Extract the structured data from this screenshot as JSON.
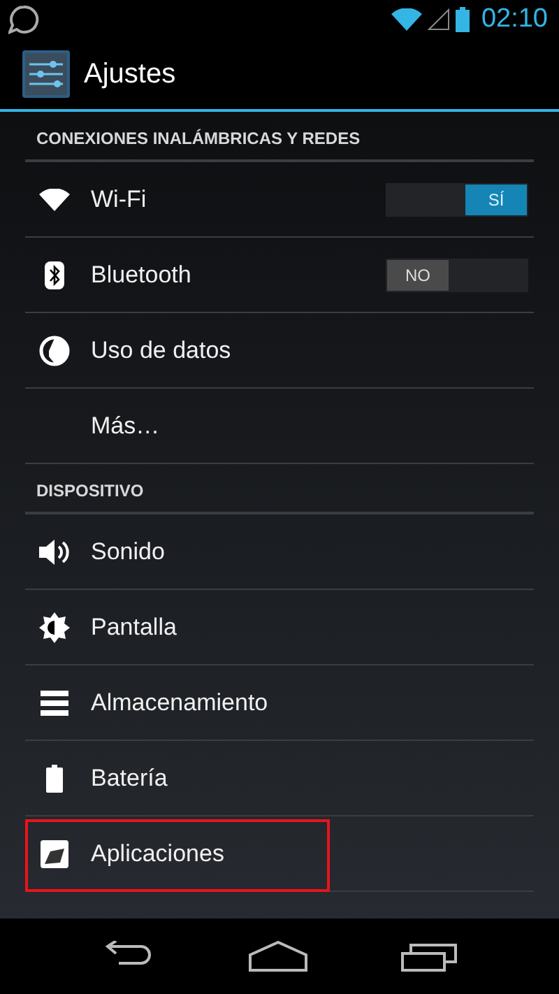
{
  "status_bar": {
    "time": "02:10"
  },
  "action_bar": {
    "title": "Ajustes"
  },
  "sections": [
    {
      "header": "CONEXIONES INALÁMBRICAS Y REDES",
      "items": [
        {
          "label": "Wi-Fi",
          "kind": "toggle",
          "toggle": {
            "on": true,
            "text": "SÍ"
          },
          "highlighted": false
        },
        {
          "label": "Bluetooth",
          "kind": "toggle",
          "toggle": {
            "on": false,
            "text": "NO"
          },
          "highlighted": false
        },
        {
          "label": "Uso de datos",
          "kind": "plain",
          "highlighted": false
        },
        {
          "label": "Más…",
          "kind": "plain",
          "highlighted": false
        }
      ]
    },
    {
      "header": "DISPOSITIVO",
      "items": [
        {
          "label": "Sonido",
          "kind": "plain",
          "highlighted": false
        },
        {
          "label": "Pantalla",
          "kind": "plain",
          "highlighted": false
        },
        {
          "label": "Almacenamiento",
          "kind": "plain",
          "highlighted": false
        },
        {
          "label": "Batería",
          "kind": "plain",
          "highlighted": false
        },
        {
          "label": "Aplicaciones",
          "kind": "plain",
          "highlighted": true
        }
      ]
    }
  ]
}
